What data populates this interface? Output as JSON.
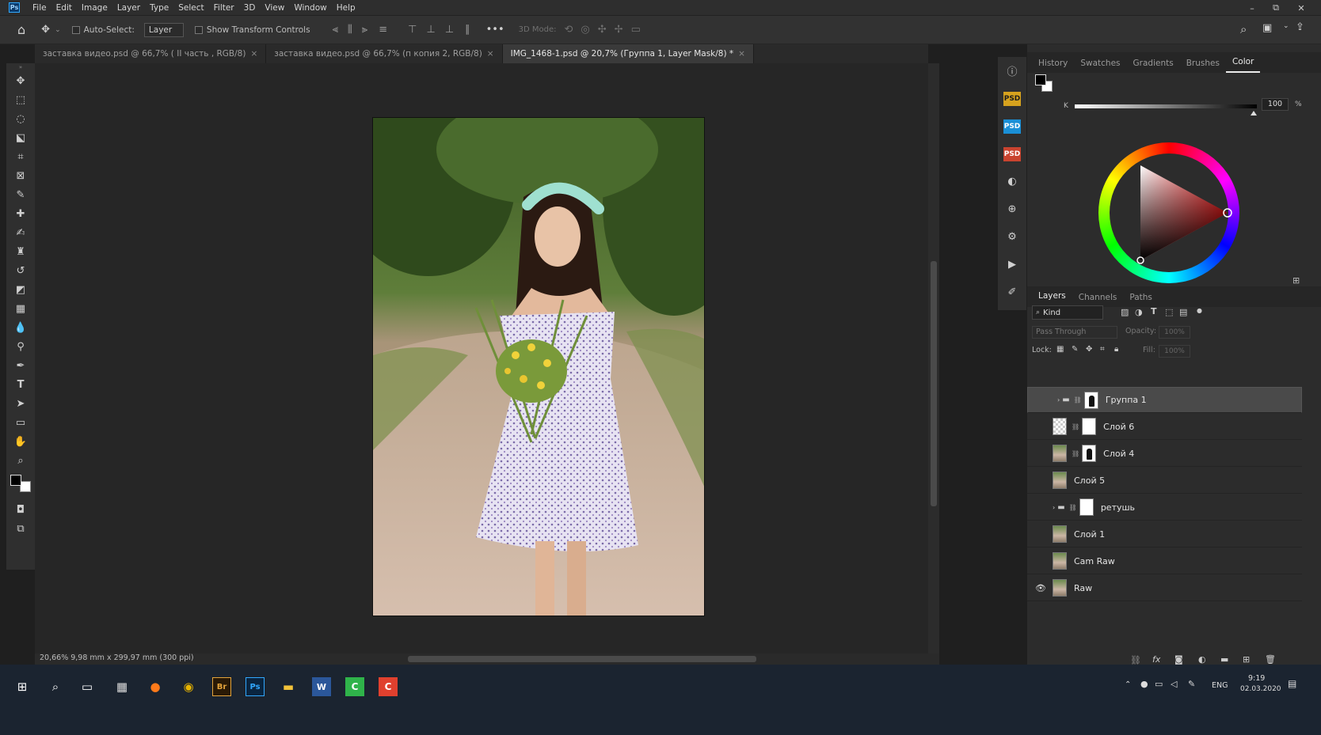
{
  "menubar": {
    "logo": "Ps",
    "items": [
      "File",
      "Edit",
      "Image",
      "Layer",
      "Type",
      "Select",
      "Filter",
      "3D",
      "View",
      "Window",
      "Help"
    ],
    "window_controls": [
      "–",
      "⧉",
      "✕"
    ]
  },
  "options_bar": {
    "auto_select_label": "Auto-Select:",
    "auto_select_value": "Layer",
    "transform_label": "Show Transform Controls",
    "more": "•••",
    "mode_3d_label": "3D Mode:"
  },
  "tabs": [
    {
      "title": "заставка видео.psd @ 66,7% ( II часть , RGB/8)",
      "close": "×"
    },
    {
      "title": "заставка видео.psd @ 66,7% (п копия 2, RGB/8)",
      "close": "×"
    },
    {
      "title": "IMG_1468-1.psd @ 20,7% (Группа 1, Layer Mask/8) *",
      "close": "×"
    }
  ],
  "status_text": "20,66%  9,98 mm x 299,97 mm (300 ppi)",
  "toolbar_icons": [
    "move-icon",
    "marquee-icon",
    "lasso-icon",
    "object-select-icon",
    "crop-icon",
    "frame-icon",
    "eyedropper-icon",
    "healing-icon",
    "brush-icon",
    "stamp-icon",
    "history-brush-icon",
    "eraser-icon",
    "gradient-icon",
    "blur-icon",
    "dodge-icon",
    "pen-icon",
    "type-icon",
    "path-select-icon",
    "rectangle-icon",
    "hand-icon",
    "zoom-icon"
  ],
  "strip": {
    "psd_label": "PSD"
  },
  "color_panel": {
    "tabs": [
      "History",
      "Swatches",
      "Gradients",
      "Brushes",
      "Color"
    ],
    "active_tab": "Color",
    "slider_label": "K",
    "slider_value": "100",
    "slider_unit": "%",
    "foreground": "#000000",
    "background": "#ffffff"
  },
  "layers_panel": {
    "tabs": [
      "Layers",
      "Channels",
      "Paths"
    ],
    "active_tab": "Layers",
    "filter_label": "Kind",
    "blend_mode": "Pass Through",
    "opacity_label": "Opacity:",
    "opacity_value": "100%",
    "lock_label": "Lock:",
    "fill_label": "Fill:",
    "fill_value": "100%",
    "layers": [
      {
        "name": "Группа 1",
        "selected": true
      },
      {
        "name": "Слой 6",
        "selected": false
      },
      {
        "name": "Слой 4",
        "selected": false
      },
      {
        "name": "Слой 5",
        "selected": false
      },
      {
        "name": "ретушь",
        "selected": false
      },
      {
        "name": "Слой 1",
        "selected": false
      },
      {
        "name": "Cam Raw",
        "selected": false
      },
      {
        "name": "Raw",
        "selected": false
      }
    ]
  },
  "taskbar": {
    "lang": "ENG",
    "time": "9:19",
    "date": "02.03.2020"
  }
}
